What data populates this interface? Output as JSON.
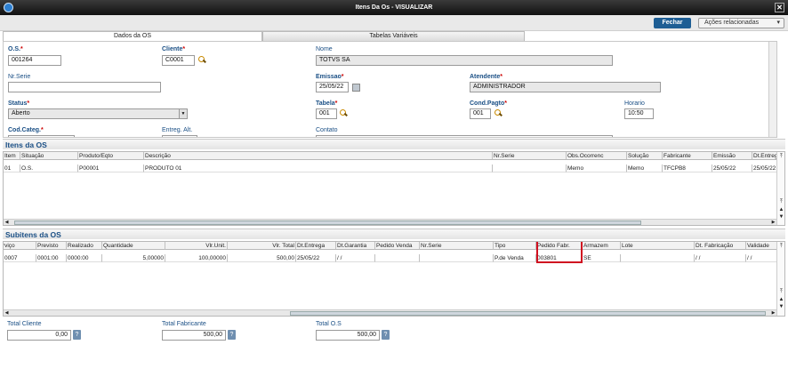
{
  "window": {
    "title": "Itens Da Os - VISUALIZAR"
  },
  "toolbar": {
    "close_label": "Fechar",
    "actions_label": "Ações relacionadas"
  },
  "tabs": [
    "Dados da OS",
    "Tabelas Variáveis"
  ],
  "form": {
    "os": {
      "label": "O.S.",
      "value": "001264"
    },
    "cliente": {
      "label": "Cliente",
      "value": "C0001"
    },
    "nome": {
      "label": "Nome",
      "value": "TOTVS SA"
    },
    "nr_serie": {
      "label": "Nr.Serie",
      "value": ""
    },
    "emissao": {
      "label": "Emissao",
      "value": "25/05/22"
    },
    "atendente": {
      "label": "Atendente",
      "value": "ADMINISTRADOR"
    },
    "status": {
      "label": "Status",
      "value": "Aberto"
    },
    "tabela": {
      "label": "Tabela",
      "value": "001"
    },
    "cond_pagto": {
      "label": "Cond.Pagto",
      "value": "001"
    },
    "horario": {
      "label": "Horario",
      "value": "10:50"
    },
    "cod_categ": {
      "label": "Cod.Categ."
    },
    "entreg_alt": {
      "label": "Entreg. Alt."
    },
    "contato": {
      "label": "Contato"
    }
  },
  "itens": {
    "title": "Itens da OS",
    "columns": [
      "Item",
      "Situação",
      "Produto/Eqto",
      "Descrição",
      "Nr.Serie",
      "Obs.Ocorrenc",
      "Solução",
      "Fabricante",
      "Emissão",
      "Dt.Entrega"
    ],
    "rows": [
      [
        "01",
        "O.S.",
        "P00001",
        "PRODUTO 01",
        "",
        "Memo",
        "Memo",
        "TFCPB8",
        "25/05/22",
        "25/05/22"
      ]
    ]
  },
  "subitens": {
    "title": "Subitens da OS",
    "columns": [
      "Serviço",
      "Previsto",
      "Realizado",
      "Quantidade",
      "Vlr.Unit.",
      "Vlr. Total",
      "Dt.Entrega",
      "Dt.Garantia",
      "Pedido Venda",
      "Nr.Serie",
      "Tipo",
      "Pedido Fabr.",
      "Armazem",
      "Lote",
      "Dt. Fabricação",
      "Validade"
    ],
    "rows": [
      [
        "0007",
        "0001:00",
        "0000:00",
        "5,00000",
        "100,00000",
        "500,00",
        "25/05/22",
        "/  /",
        "",
        "",
        "P.de Venda",
        "003801",
        "SE",
        "",
        "/  /",
        "/  /"
      ]
    ]
  },
  "totals": {
    "total_cliente": {
      "label": "Total Cliente",
      "value": "0,00"
    },
    "total_fabricante": {
      "label": "Total Fabricante",
      "value": "500,00"
    },
    "total_os": {
      "label": "Total O.S",
      "value": "500,00"
    }
  }
}
